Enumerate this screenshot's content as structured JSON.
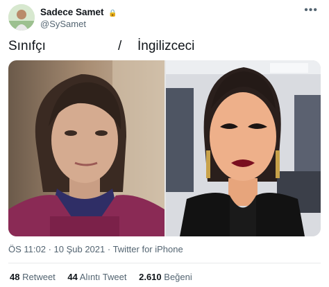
{
  "author": {
    "display_name": "Sadece Samet",
    "handle": "@SySamet",
    "more_icon": "ellipsis-icon"
  },
  "tweet": {
    "caption_left": "Sınıfçı",
    "caption_sep": "/",
    "caption_right": "İngilizceci",
    "timestamp": "ÖS 11:02 · 10 Şub 2021 · Twitter for iPhone"
  },
  "stats": {
    "retweets_count": "48",
    "retweets_label": "Retweet",
    "quotes_count": "44",
    "quotes_label": "Alıntı Tweet",
    "likes_count": "2.610",
    "likes_label": "Beğeni"
  }
}
